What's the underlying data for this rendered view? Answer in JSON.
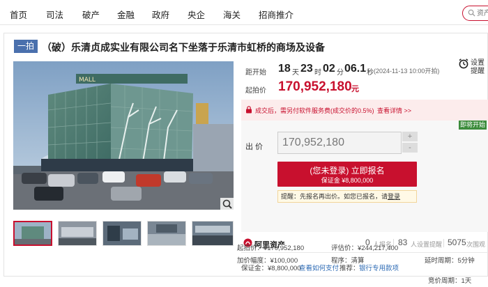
{
  "nav": {
    "items": [
      "首页",
      "司法",
      "破产",
      "金融",
      "政府",
      "央企",
      "海关",
      "招商推介"
    ],
    "search_placeholder": "资产"
  },
  "listing": {
    "tag": "一拍",
    "title": "（破）乐清贞成实业有限公司名下坐落于乐清市虹桥的商场及设备"
  },
  "countdown": {
    "label": "距开始",
    "days": "18",
    "days_unit": "天",
    "hours": "23",
    "hours_unit": "时",
    "minutes": "02",
    "minutes_unit": "分",
    "seconds": "06.1",
    "seconds_unit": "秒",
    "start_time": "(2024-11-13 10:00开拍)"
  },
  "reminder": {
    "line1": "设置",
    "line2": "提醒",
    "icon": "alarm-clock-icon"
  },
  "starting_price": {
    "label": "起拍价",
    "value": "170,952,180",
    "unit": "元"
  },
  "notice": {
    "text": "成交后，需另付软件服务费(成交价的0.5%)",
    "link": "查看详情 >>"
  },
  "bid": {
    "badge": "即将开始",
    "label": "出  价",
    "value": "170,952,180",
    "plus": "+",
    "minus": "-",
    "button_line1": "(您未登录) 立即报名",
    "button_line2": "保证金 ¥8,800,000",
    "tip_text": "提醒：先报名再出价。如您已报名，请",
    "tip_link": "登录"
  },
  "platform": {
    "name": "阿里资产",
    "applicants_num": "0",
    "applicants_label": "人报名",
    "reminders_num": "83",
    "reminders_label": "人设置提醒",
    "views_num": "5075",
    "views_label": "次围观"
  },
  "details": {
    "deposit": "保证金：¥8,800,000",
    "how_to_pay": "查看如何支付",
    "recommend_label": "推荐：",
    "recommend_link": "银行专用款项",
    "bid_period": "竞价周期：1天",
    "start_price": "起拍价：¥170,952,180",
    "appraisal": "评估价：¥244,217,400",
    "extension": "延时周期：5分钟",
    "increment": "加价幅度：¥100,000",
    "procedure": "程序：清算"
  },
  "colors": {
    "accent": "#c8102e",
    "brand_blue": "#4a70ad",
    "success_green": "#3c8c3c",
    "link_blue": "#2d6bb5"
  }
}
